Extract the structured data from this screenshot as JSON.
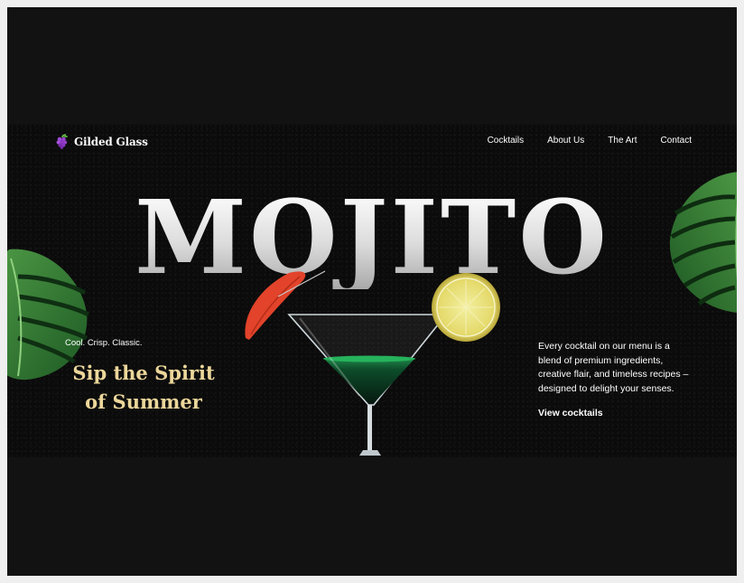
{
  "brand": {
    "name": "Gilded Glass",
    "icon": "grapes-icon"
  },
  "nav": {
    "items": [
      {
        "label": "Cocktails"
      },
      {
        "label": "About Us"
      },
      {
        "label": "The Art"
      },
      {
        "label": "Contact"
      }
    ]
  },
  "hero": {
    "title": "MOJITO",
    "tagline": "Cool. Crisp. Classic.",
    "headline_line1": "Sip the Spirit",
    "headline_line2": "of Summer",
    "description": "Every cocktail on our menu is a blend of premium ingredients, creative flair, and timeless recipes – designed to delight your senses.",
    "cta_label": "View cocktails"
  },
  "colors": {
    "accent_gold": "#ecd79a",
    "background": "#0b0b0b",
    "page_frame": "#121212"
  }
}
